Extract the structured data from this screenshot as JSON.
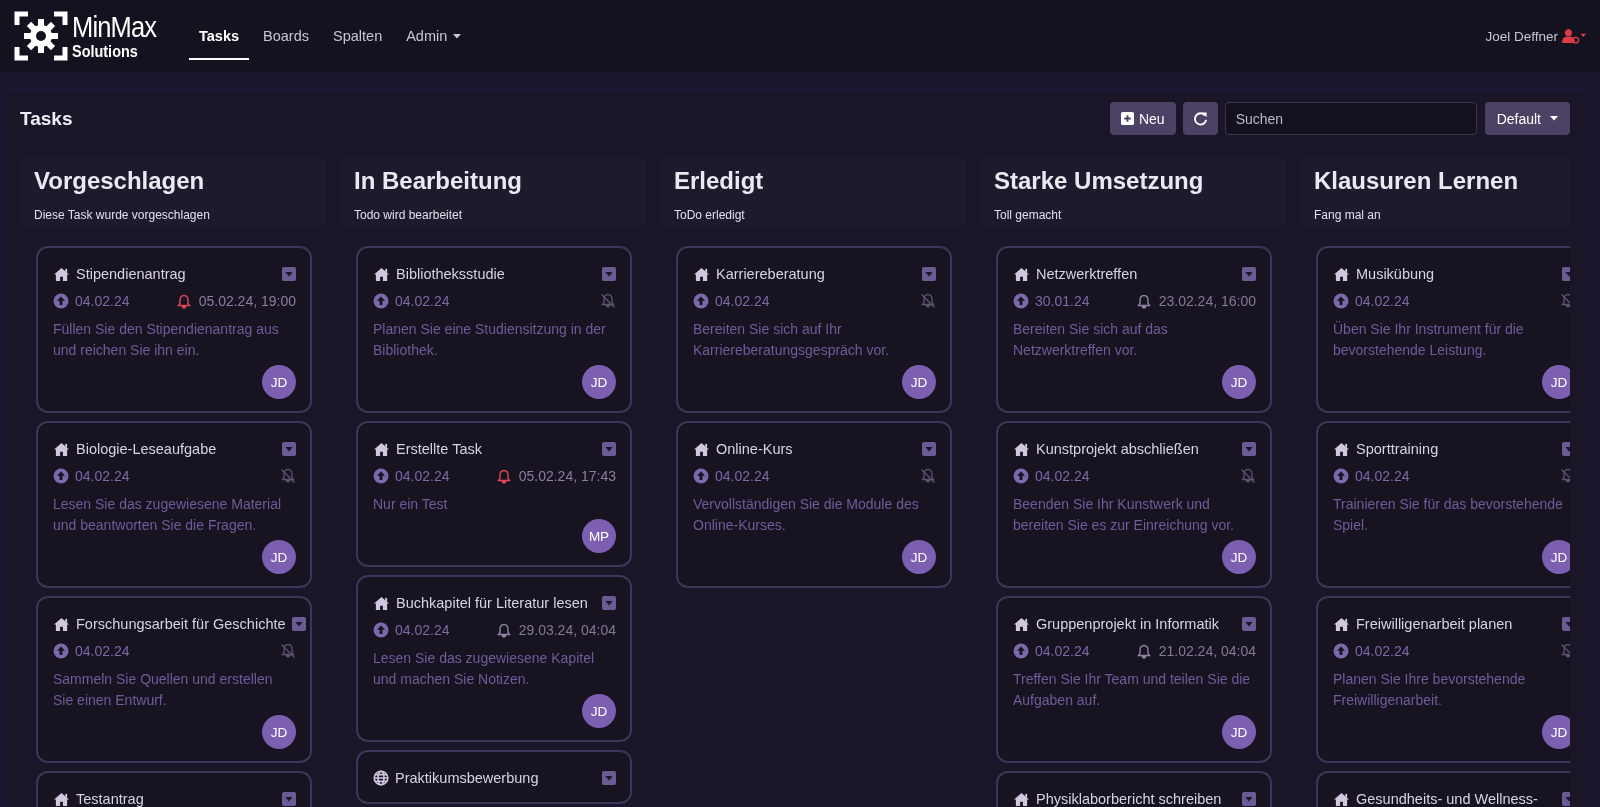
{
  "header": {
    "logo": {
      "line_1": "MinMax",
      "line_2": "Solutions"
    },
    "nav": [
      {
        "label": "Tasks",
        "selected": true,
        "dropdown": false
      },
      {
        "label": "Boards",
        "selected": false,
        "dropdown": false
      },
      {
        "label": "Spalten",
        "selected": false,
        "dropdown": false
      },
      {
        "label": "Admin",
        "selected": false,
        "dropdown": true
      }
    ],
    "user": "Joel Deffner"
  },
  "board": {
    "title": "Tasks",
    "new_button": "Neu",
    "search": {
      "placeholder": "Suchen"
    },
    "view_select": "Default",
    "columns": [
      {
        "title": "Vorgeschlagen",
        "subtitle": "Diese Task wurde vorgeschlagen",
        "cards": [
          {
            "kind": "home",
            "title": "Stipendienantrag",
            "created": "04.02.24",
            "reminder": "05.02.24, 19:00",
            "reminder_overdue": true,
            "description": "Füllen Sie den Stipendienantrag aus und reichen Sie ihn ein.",
            "assignee": "JD"
          },
          {
            "kind": "home",
            "title": "Biologie-Leseaufgabe",
            "created": "04.02.24",
            "description": "Lesen Sie das zugewiesene Material und beantworten Sie die Fragen.",
            "assignee": "JD"
          },
          {
            "kind": "home",
            "title": "Forschungsarbeit für Geschichte",
            "created": "04.02.24",
            "description": "Sammeln Sie Quellen und erstellen Sie einen Entwurf.",
            "assignee": "JD"
          },
          {
            "kind": "home",
            "title": "Testantrag"
          }
        ]
      },
      {
        "title": "In Bearbeitung",
        "subtitle": "Todo wird bearbeitet",
        "cards": [
          {
            "kind": "home",
            "title": "Bibliotheksstudie",
            "created": "04.02.24",
            "description": "Planen Sie eine Studiensitzung in der Bibliothek.",
            "assignee": "JD"
          },
          {
            "kind": "home",
            "title": "Erstellte Task",
            "created": "04.02.24",
            "reminder": "05.02.24, 17:43",
            "reminder_overdue": true,
            "description": "Nur ein Test",
            "assignee": "MP"
          },
          {
            "kind": "home",
            "title": "Buchkapitel für Literatur lesen",
            "created": "04.02.24",
            "reminder": "29.03.24, 04:04",
            "reminder_overdue": false,
            "description": "Lesen Sie das zugewiesene Kapitel und machen Sie Notizen.",
            "assignee": "JD"
          },
          {
            "kind": "globe",
            "title": "Praktikumsbewerbung"
          }
        ]
      },
      {
        "title": "Erledigt",
        "subtitle": "ToDo erledigt",
        "cards": [
          {
            "kind": "home",
            "title": "Karriereberatung",
            "created": "04.02.24",
            "description": "Bereiten Sie sich auf Ihr Karriereberatungsgespräch vor.",
            "assignee": "JD"
          },
          {
            "kind": "home",
            "title": "Online-Kurs",
            "created": "04.02.24",
            "description": "Vervollständigen Sie die Module des Online-Kurses.",
            "assignee": "JD"
          }
        ]
      },
      {
        "title": "Starke Umsetzung",
        "subtitle": "Toll gemacht",
        "cards": [
          {
            "kind": "home",
            "title": "Netzwerktreffen",
            "created": "30.01.24",
            "reminder": "23.02.24, 16:00",
            "reminder_overdue": false,
            "description": "Bereiten Sie sich auf das Netzwerktreffen vor.",
            "assignee": "JD"
          },
          {
            "kind": "home",
            "title": "Kunstprojekt abschließen",
            "created": "04.02.24",
            "description": "Beenden Sie Ihr Kunstwerk und bereiten Sie es zur Einreichung vor.",
            "assignee": "JD"
          },
          {
            "kind": "home",
            "title": "Gruppenprojekt in Informatik",
            "created": "04.02.24",
            "reminder": "21.02.24, 04:04",
            "reminder_overdue": false,
            "description": "Treffen Sie Ihr Team und teilen Sie die Aufgaben auf.",
            "assignee": "JD"
          },
          {
            "kind": "home",
            "title": "Physiklaborbericht schreiben"
          }
        ]
      },
      {
        "title": "Klausuren Lernen",
        "subtitle": "Fang mal an",
        "cards": [
          {
            "kind": "home",
            "title": "Musikübung",
            "created": "04.02.24",
            "description": "Üben Sie Ihr Instrument für die bevorstehende Leistung.",
            "assignee": "JD"
          },
          {
            "kind": "home",
            "title": "Sporttraining",
            "created": "04.02.24",
            "description": "Trainieren Sie für das bevorstehende Spiel.",
            "assignee": "JD"
          },
          {
            "kind": "home",
            "title": "Freiwilligenarbeit planen",
            "created": "04.02.24",
            "description": "Planen Sie Ihre bevorstehende Freiwilligenarbeit.",
            "assignee": "JD"
          },
          {
            "kind": "home",
            "title": "Gesundheits- und Wellness-"
          }
        ]
      }
    ]
  }
}
